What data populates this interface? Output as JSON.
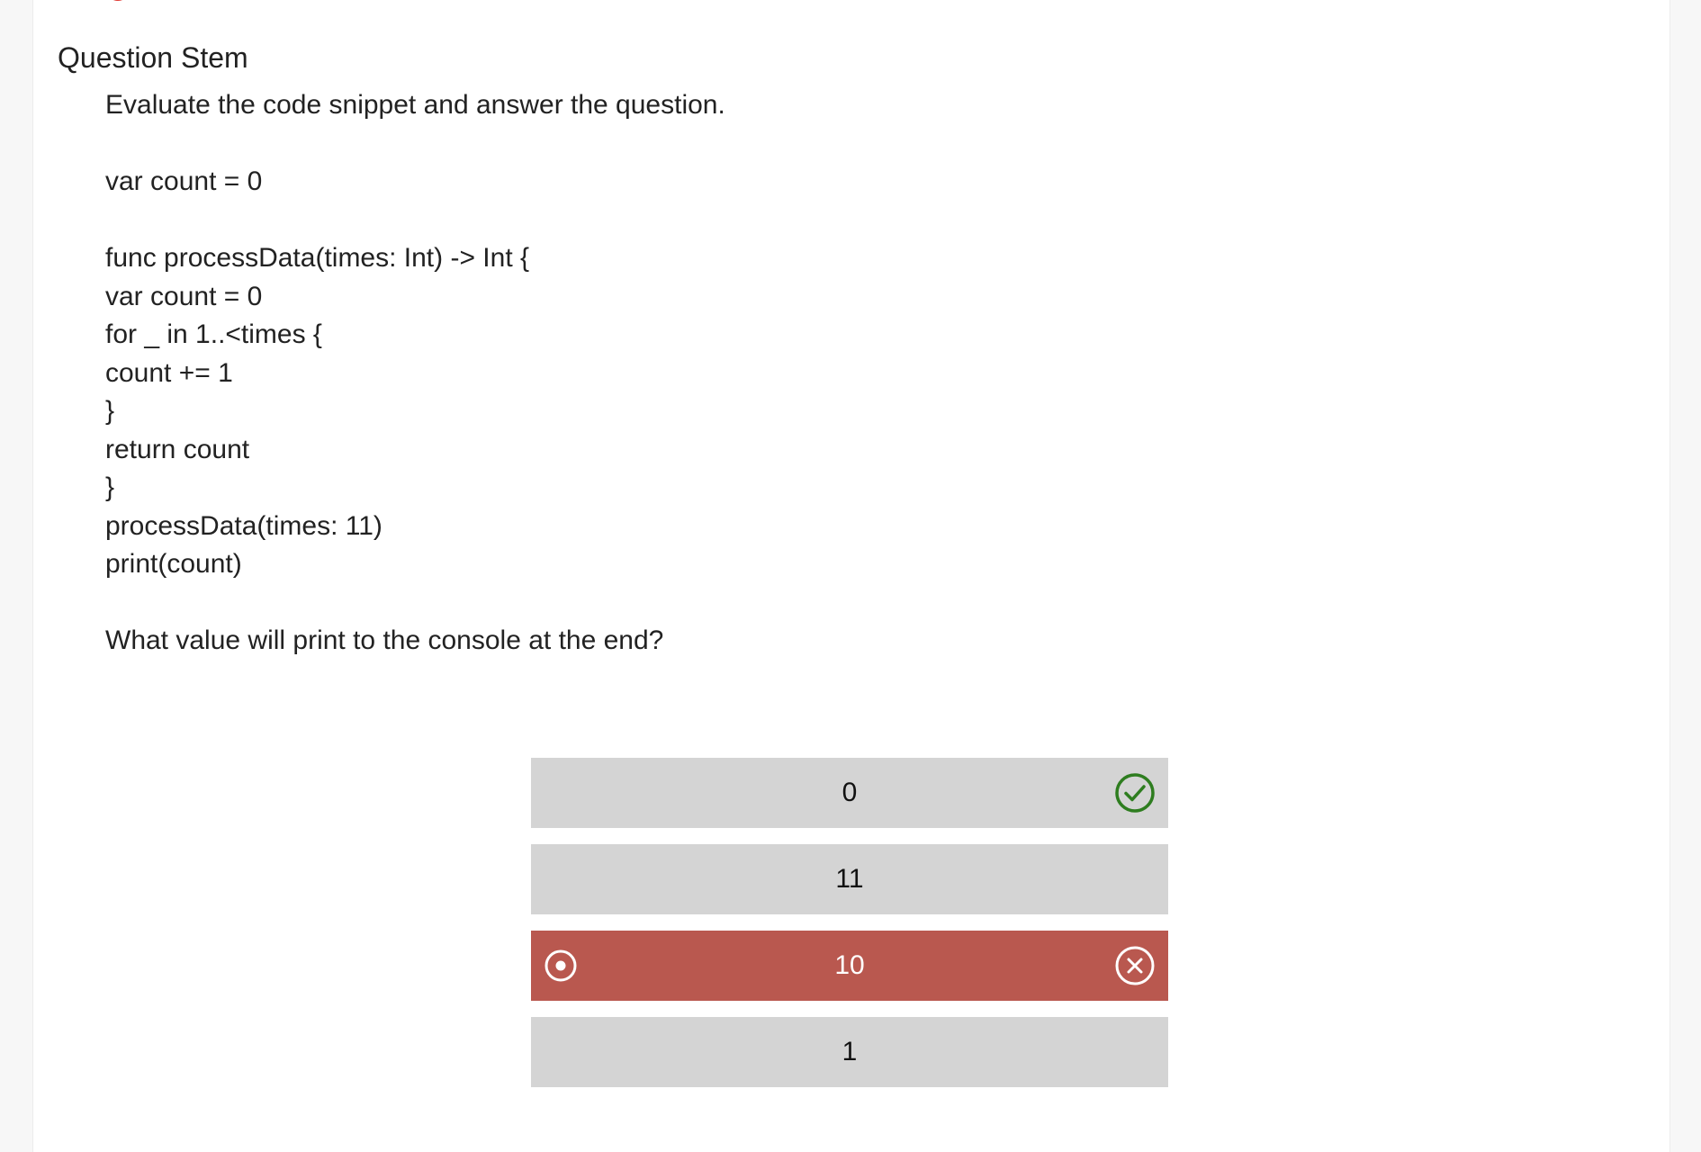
{
  "section": {
    "title": "Question Stem"
  },
  "stem": {
    "lines": [
      "Evaluate the code snippet and answer the question.",
      "",
      "var count = 0",
      "",
      "func processData(times: Int) -> Int {",
      "var count = 0",
      "for _ in 1..<times {",
      "count += 1",
      "}",
      "return count",
      "}",
      "processData(times: 11)",
      "print(count)",
      "",
      "What value will print to the console at the end?"
    ]
  },
  "options": [
    {
      "label": "0",
      "state": "correct",
      "status_icon": "check-circle-icon"
    },
    {
      "label": "11",
      "state": "neutral"
    },
    {
      "label": "10",
      "state": "selected-wrong",
      "selection_icon": "radio-selected-icon",
      "status_icon": "x-circle-icon"
    },
    {
      "label": "1",
      "state": "neutral"
    }
  ],
  "colors": {
    "option_bg": "#d4d4d4",
    "wrong_bg": "#b9584f",
    "correct_icon": "#2e7d1f",
    "accent_red": "#e03a34"
  }
}
